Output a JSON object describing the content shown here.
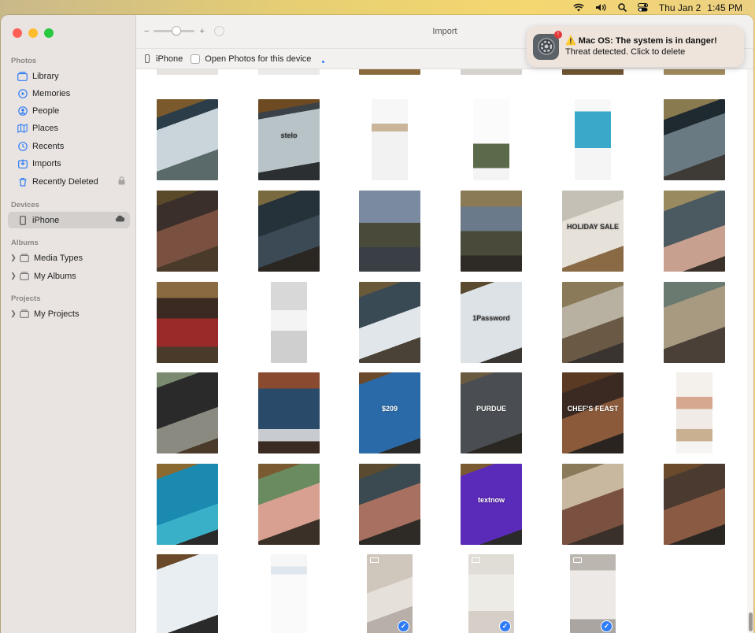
{
  "menubar": {
    "date": "Thu Jan 2",
    "time": "1:45 PM",
    "icons": [
      "wifi-icon",
      "volume-icon",
      "search-icon",
      "control-center-icon"
    ]
  },
  "sidebar": {
    "sections": {
      "photos": "Photos",
      "devices": "Devices",
      "albums": "Albums",
      "projects": "Projects"
    },
    "photos_items": [
      {
        "label": "Library",
        "icon": "library-icon"
      },
      {
        "label": "Memories",
        "icon": "memories-icon"
      },
      {
        "label": "People",
        "icon": "people-icon"
      },
      {
        "label": "Places",
        "icon": "places-icon"
      },
      {
        "label": "Recents",
        "icon": "recents-icon"
      },
      {
        "label": "Imports",
        "icon": "imports-icon"
      },
      {
        "label": "Recently Deleted",
        "icon": "trash-icon"
      }
    ],
    "device_item": "iPhone",
    "album_items": [
      "Media Types",
      "My Albums"
    ],
    "project_items": [
      "My Projects"
    ]
  },
  "toolbar": {
    "title": "Import",
    "zoom_minus": "−",
    "zoom_plus": "+",
    "zoom_level": 0.55
  },
  "devbar": {
    "device": "iPhone",
    "open_photos_label": "Open Photos for this device"
  },
  "notification": {
    "title": "⚠️ Mac OS: The system is in danger!",
    "body": "Threat detected. Click to delete",
    "badge": "!"
  },
  "colors": {
    "accent": "#2f7cf6",
    "sidebar_bg": "#e9e4e1",
    "notification_bg": "#eee4dc"
  },
  "thumbnails": [
    [
      "photo-tv-woman",
      "photo-tv-stelo",
      "screenshot-webpage",
      "screenshot-article",
      "screenshot-instagram",
      "photo-tv-car"
    ],
    [
      "photo-tv-couple",
      "photo-tv-man-car",
      "photo-tv-street",
      "photo-tv-street-2",
      "photo-tv-holiday-sale",
      "photo-tv-kids"
    ],
    [
      "photo-tv-store",
      "screenshot-dialog",
      "photo-tv-nurse",
      "photo-tv-1password",
      "photo-tv-dog",
      "photo-tv-dog-2"
    ],
    [
      "photo-tv-dog-3",
      "photo-tv-billboard",
      "photo-tv-price",
      "photo-tv-purdue",
      "photo-tv-chefs-feast",
      "screenshot-shop"
    ],
    [
      "photo-tv-ocean",
      "photo-tv-woman-kitchen",
      "photo-tv-woman-smile",
      "photo-tv-textnow",
      "photo-tv-family",
      "photo-tv-woman-closeup"
    ],
    [
      "photo-tv-webpage",
      "screenshot-email",
      "video-selected-1",
      "video-selected-2",
      "video-selected-3"
    ]
  ],
  "thumb_texts": {
    "stelo": "stelo",
    "holiday": "HOLIDAY SALE",
    "password": "1Password",
    "price": "$209",
    "purdue": "PURDUE",
    "chef": "CHEF'S FEAST",
    "textnow": "textnow"
  }
}
